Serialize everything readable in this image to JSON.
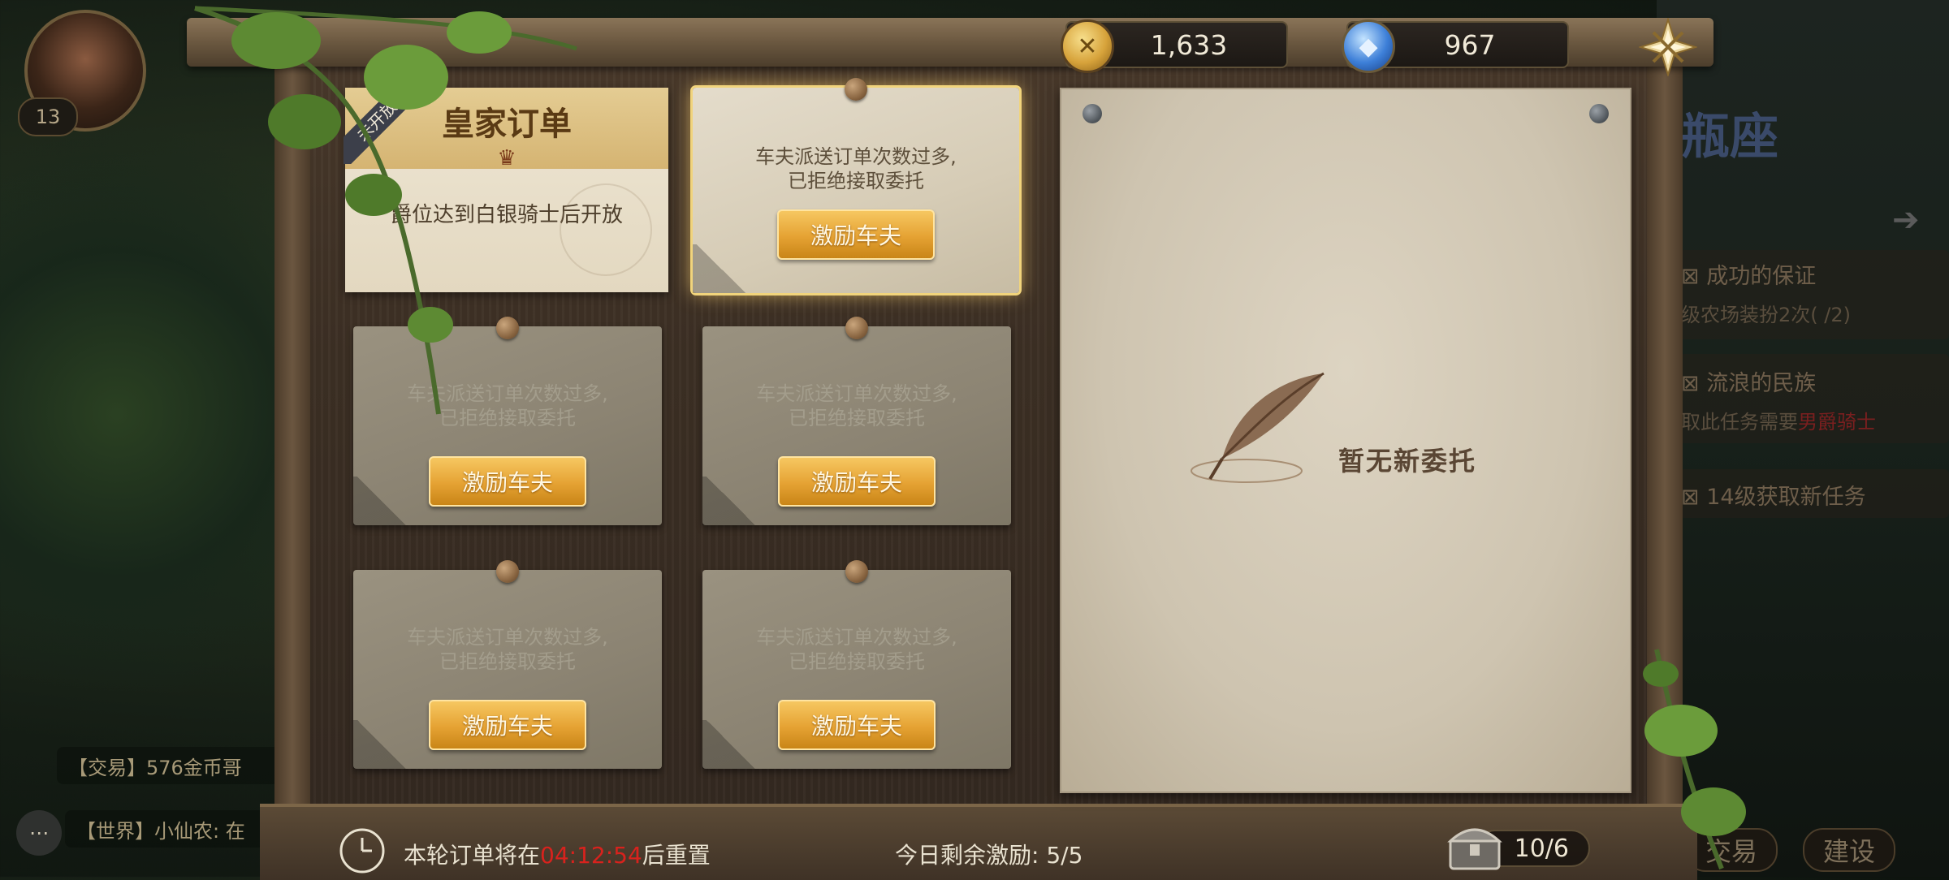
{
  "player": {
    "level": "13"
  },
  "currency": {
    "gold": "1,633",
    "gems": "967"
  },
  "royal_order": {
    "title": "皇家订单",
    "ribbon": "未开放",
    "message": "爵位达到白银骑士后开放"
  },
  "orders": [
    {
      "line1": "车夫派送订单次数过多,",
      "line2": "已拒绝接取委托",
      "button": "激励车夫",
      "active": true
    },
    {
      "line1": "车夫派送订单次数过多,",
      "line2": "已拒绝接取委托",
      "button": "激励车夫",
      "active": false
    },
    {
      "line1": "车夫派送订单次数过多,",
      "line2": "已拒绝接取委托",
      "button": "激励车夫",
      "active": false
    },
    {
      "line1": "车夫派送订单次数过多,",
      "line2": "已拒绝接取委托",
      "button": "激励车夫",
      "active": false
    },
    {
      "line1": "车夫派送订单次数过多,",
      "line2": "已拒绝接取委托",
      "button": "激励车夫",
      "active": false
    }
  ],
  "detail": {
    "empty_text": "暂无新委托"
  },
  "footer": {
    "reset_prefix": "本轮订单将在",
    "reset_time": "04:12:54",
    "reset_suffix": "后重置",
    "remaining_label": "今日剩余激励:",
    "remaining_value": "5/5",
    "chest_count": "10/6"
  },
  "chat": {
    "trade": "【交易】576金币哥",
    "world": "【世界】小仙农: 在"
  },
  "side_panel": {
    "title": "瓶座",
    "quests": [
      {
        "name": "成功的保证",
        "detail": "级农场装扮2次( /2)"
      },
      {
        "name": "流浪的民族",
        "detail": "取此任务需要",
        "detail_red": "男爵骑士"
      },
      {
        "name": "14级获取新任务"
      }
    ],
    "buttons": [
      "交易",
      "建设"
    ]
  },
  "colors": {
    "button_gold": "#e5a233",
    "timer_red": "#d8221d",
    "paper": "#d6ccb6",
    "wood": "#3c2f24"
  }
}
